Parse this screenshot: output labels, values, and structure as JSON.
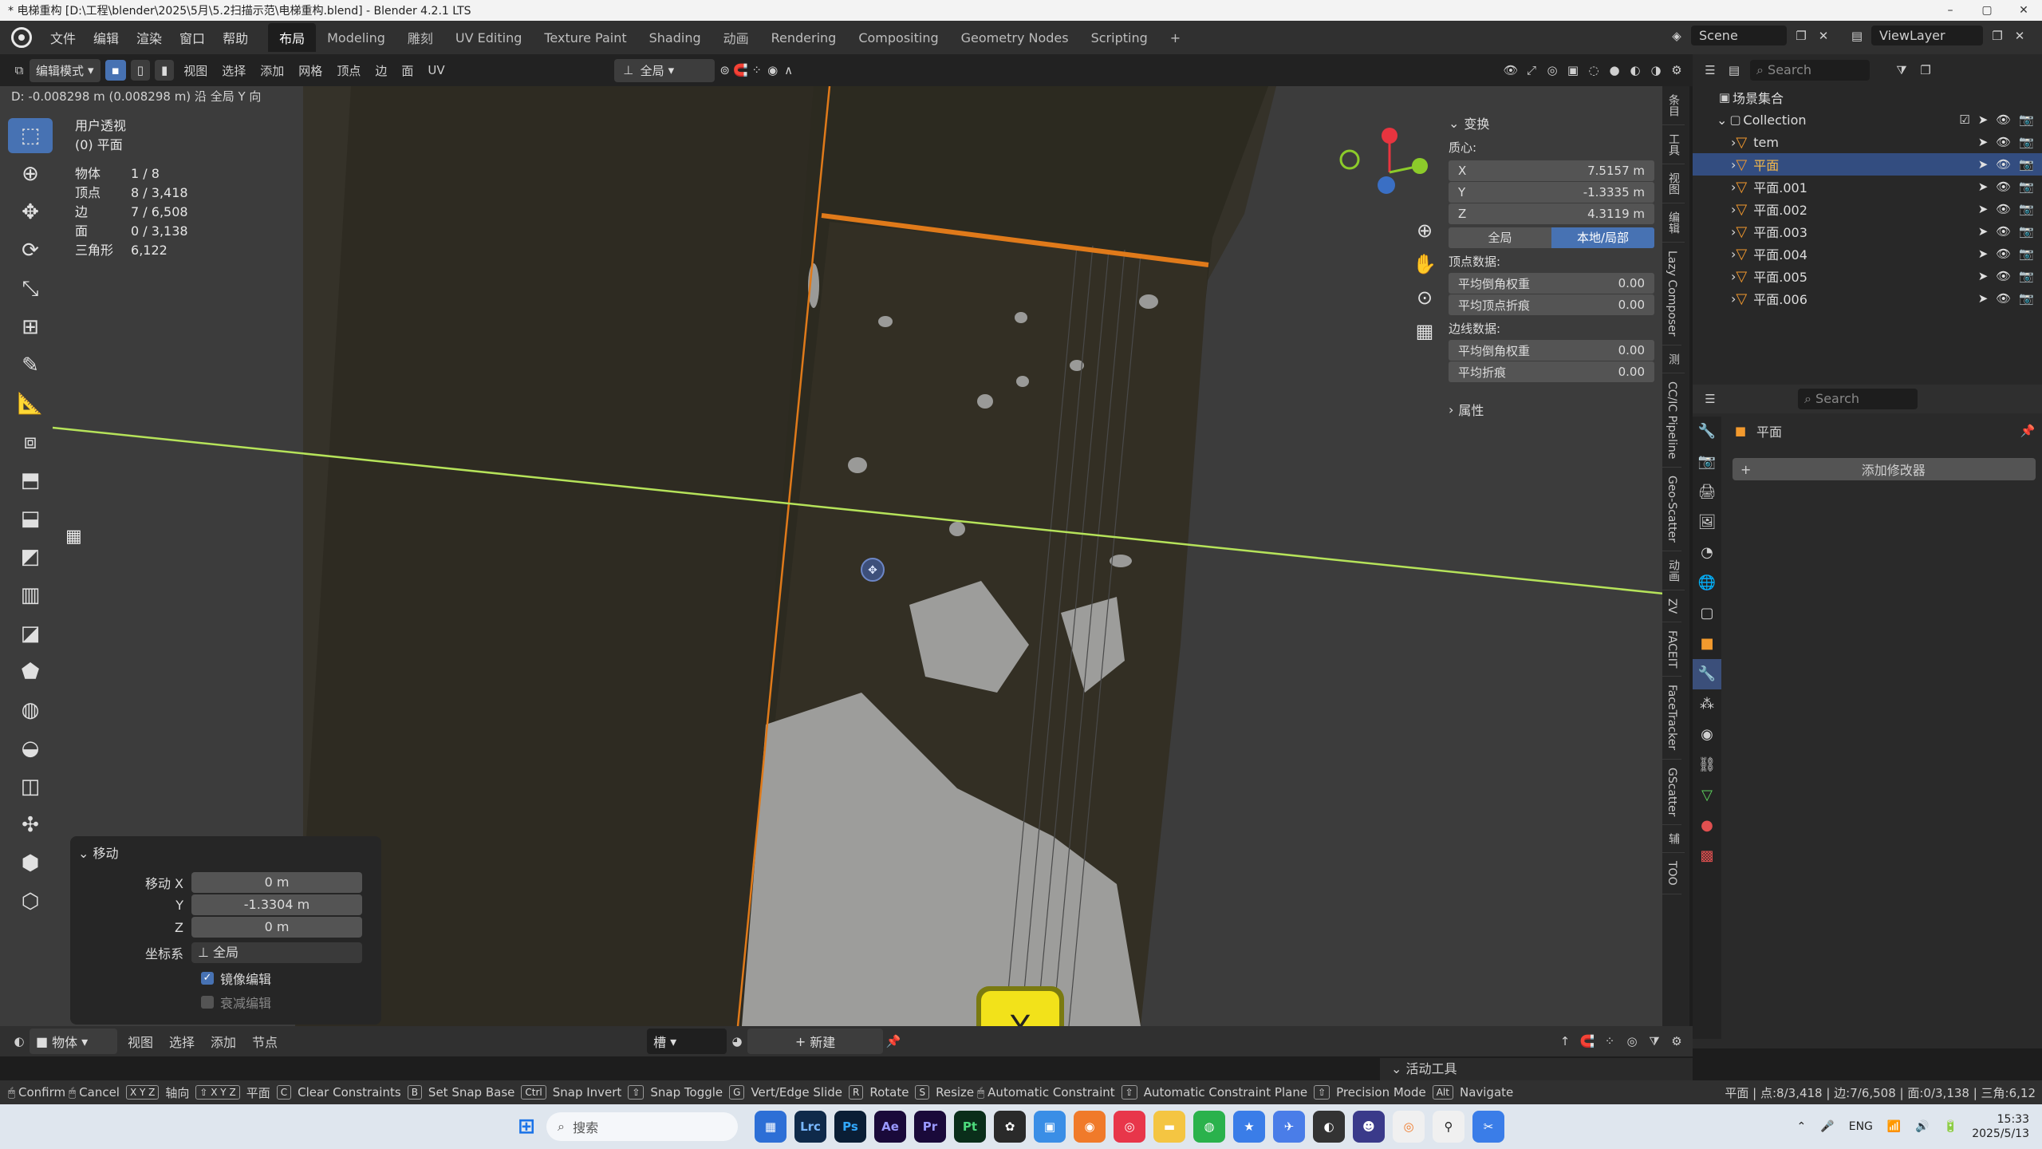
{
  "titlebar": {
    "title": "* 电梯重构 [D:\\工程\\blender\\2025\\5月\\5.2扫描示范\\电梯重构.blend] - Blender 4.2.1 LTS",
    "minimize": "–",
    "maximize": "▢",
    "close": "✕"
  },
  "menu": {
    "items": [
      "文件",
      "编辑",
      "渲染",
      "窗口",
      "帮助"
    ],
    "workspaces": [
      "布局",
      "Modeling",
      "雕刻",
      "UV Editing",
      "Texture Paint",
      "Shading",
      "动画",
      "Rendering",
      "Compositing",
      "Geometry Nodes",
      "Scripting",
      "+"
    ],
    "active_workspace": "布局",
    "scene_label": "Scene",
    "view_layer_label": "ViewLayer"
  },
  "viewport_header": {
    "mode": "编辑模式",
    "menus": [
      "视图",
      "选择",
      "添加",
      "网格",
      "顶点",
      "边",
      "面",
      "UV"
    ],
    "orientation": "全局"
  },
  "status_line": "D: -0.008298 m (0.008298 m) 沿 全局 Y 向",
  "view_info": {
    "line1": "用户透视",
    "line2": "(0) 平面"
  },
  "stats": [
    {
      "label": "物体",
      "value": "1 / 8"
    },
    {
      "label": "顶点",
      "value": "8 / 3,418"
    },
    {
      "label": "边",
      "value": "7 / 6,508"
    },
    {
      "label": "面",
      "value": "0 / 3,138"
    },
    {
      "label": "三角形",
      "value": "6,122"
    }
  ],
  "npanel": {
    "section_title": "变换",
    "median_label": "质心:",
    "x_label": "X",
    "x_value": "7.5157 m",
    "y_label": "Y",
    "y_value": "-1.3335 m",
    "z_label": "Z",
    "z_value": "4.3119 m",
    "global_btn": "全局",
    "local_btn": "本地/局部",
    "vertex_data_label": "顶点数据:",
    "vertex_bevel_label": "平均倒角权重",
    "vertex_bevel_value": "0.00",
    "vertex_crease_label": "平均顶点折痕",
    "vertex_crease_value": "0.00",
    "edge_data_label": "边线数据:",
    "edge_bevel_label": "平均倒角权重",
    "edge_bevel_value": "0.00",
    "edge_crease_label": "平均折痕",
    "edge_crease_value": "0.00",
    "properties_title": "属性"
  },
  "side_tabs": [
    "条目",
    "工具",
    "视图",
    "编辑",
    "Lazy Composer",
    "测",
    "CC/IC Pipeline",
    "Geo-Scatter",
    "动画",
    "ZV",
    "FACEIT",
    "FaceTracker",
    "GScatter",
    "辅",
    "TOO"
  ],
  "move_panel": {
    "title": "移动",
    "x_label": "移动 X",
    "x_value": "0 m",
    "y_label": "Y",
    "y_value": "-1.3304 m",
    "z_label": "Z",
    "z_value": "0 m",
    "coord_label": "坐标系",
    "coord_value": "全局",
    "mirror_label": "镜像编辑",
    "falloff_label": "衰减编辑"
  },
  "outliner": {
    "search_placeholder": "Search",
    "root": "场景集合",
    "collection": "Collection",
    "objects": [
      "tem",
      "平面",
      "平面.001",
      "平面.002",
      "平面.003",
      "平面.004",
      "平面.005",
      "平面.006"
    ],
    "selected": "平面"
  },
  "properties": {
    "search_placeholder": "Search",
    "object_name": "平面",
    "add_modifier": "添加修改器"
  },
  "bottom_header": {
    "mode": "物体",
    "menus": [
      "视图",
      "选择",
      "添加",
      "节点"
    ],
    "slot": "槽",
    "new_btn": "新建",
    "active_tool": "活动工具"
  },
  "keycap": "Y",
  "statusbar": [
    {
      "key": "",
      "text": "Confirm"
    },
    {
      "key": "",
      "text": "Cancel"
    },
    {
      "key": "X Y Z",
      "text": "轴向"
    },
    {
      "key": "⇧ X Y Z",
      "text": "平面"
    },
    {
      "key": "C",
      "text": "Clear Constraints"
    },
    {
      "key": "B",
      "text": "Set Snap Base"
    },
    {
      "key": "Ctrl",
      "text": "Snap Invert"
    },
    {
      "key": "⇧",
      "text": "Snap Toggle"
    },
    {
      "key": "G",
      "text": "Vert/Edge Slide"
    },
    {
      "key": "R",
      "text": "Rotate"
    },
    {
      "key": "S",
      "text": "Resize"
    },
    {
      "key": "",
      "text": "Automatic Constraint"
    },
    {
      "key": "⇧",
      "text": "Automatic Constraint Plane"
    },
    {
      "key": "⇧",
      "text": "Precision Mode"
    },
    {
      "key": "Alt",
      "text": "Navigate"
    }
  ],
  "status_right": "平面 | 点:8/3,418 | 边:7/6,508 | 面:0/3,138 | 三角:6,12",
  "taskbar": {
    "search_placeholder": "搜索",
    "apps": [
      "Lrc",
      "Ps",
      "Ae",
      "Pr",
      "Pt"
    ],
    "lang": "ENG",
    "time": "15:33",
    "date": "2025/5/13"
  },
  "colors": {
    "accent": "#4772b3",
    "selected_edge": "#e07a1a",
    "y_axis_line": "#b6e35a",
    "keycap": "#f2e21a"
  }
}
